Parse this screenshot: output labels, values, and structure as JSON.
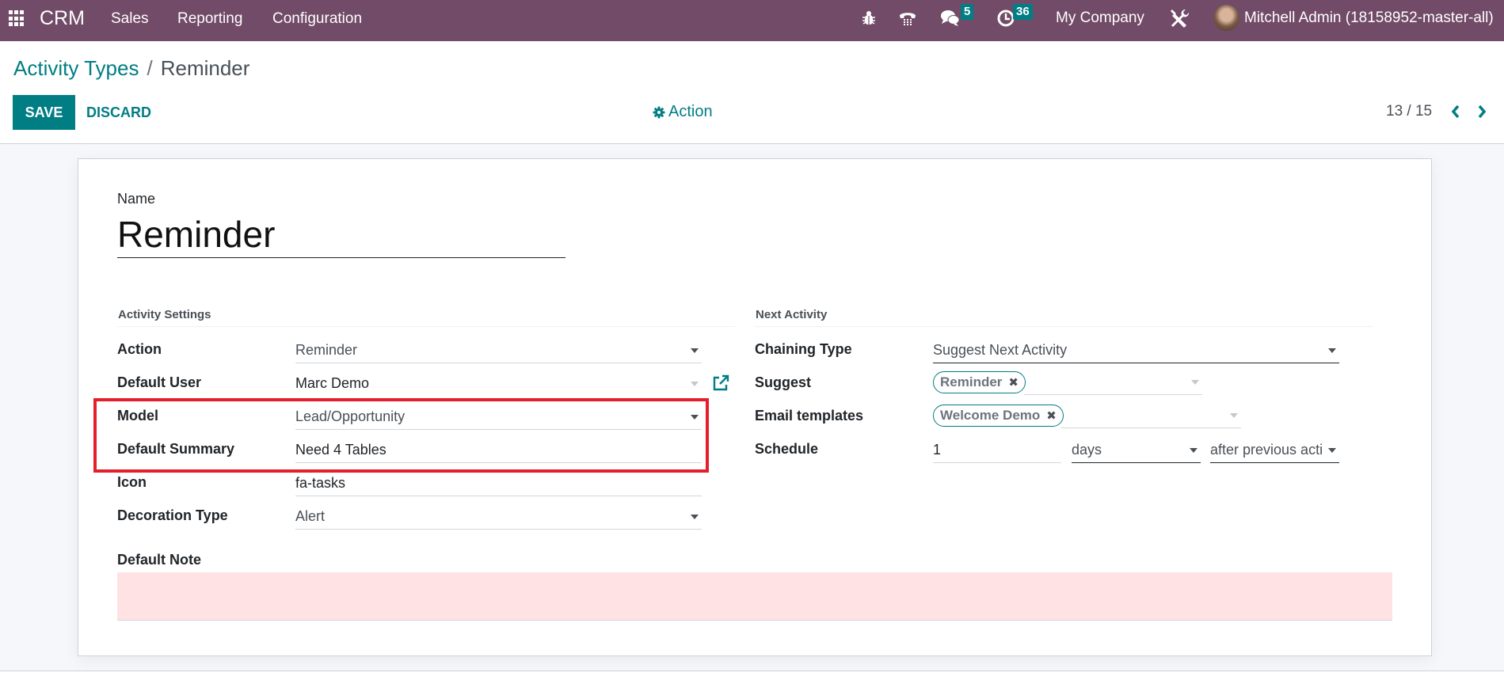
{
  "navbar": {
    "brand": "CRM",
    "menus": [
      "Sales",
      "Reporting",
      "Configuration"
    ],
    "systray": {
      "debug_icon": "bug-icon",
      "phone_icon": "phone-icon",
      "messages_icon": "comments-icon",
      "messages_count": "5",
      "activities_icon": "clock-icon",
      "activities_count": "36",
      "company": "My Company",
      "settings_icon": "tools-icon",
      "user": "Mitchell Admin (18158952-master-all)"
    },
    "color": "#714b67"
  },
  "breadcrumb": {
    "parent": "Activity Types",
    "separator": "/",
    "current": "Reminder"
  },
  "toolbar": {
    "save_label": "SAVE",
    "discard_label": "DISCARD",
    "action_label": "Action",
    "pager": "13 / 15"
  },
  "form": {
    "name_label": "Name",
    "name_value": "Reminder",
    "activity_settings": {
      "title": "Activity Settings",
      "fields": {
        "action": {
          "label": "Action",
          "value": "Reminder"
        },
        "default_user": {
          "label": "Default User",
          "value": "Marc Demo"
        },
        "model": {
          "label": "Model",
          "value": "Lead/Opportunity"
        },
        "default_summary": {
          "label": "Default Summary",
          "value": "Need 4 Tables"
        },
        "icon": {
          "label": "Icon",
          "value": "fa-tasks"
        },
        "decoration_type": {
          "label": "Decoration Type",
          "value": "Alert"
        }
      }
    },
    "next_activity": {
      "title": "Next Activity",
      "fields": {
        "chaining_type": {
          "label": "Chaining Type",
          "value": "Suggest Next Activity"
        },
        "suggest": {
          "label": "Suggest",
          "tags": [
            "Reminder"
          ]
        },
        "email_templates": {
          "label": "Email templates",
          "tags": [
            "Welcome Demo"
          ]
        },
        "schedule": {
          "label": "Schedule",
          "count": "1",
          "unit": "days",
          "relation": "after previous acti"
        }
      }
    },
    "default_note": {
      "label": "Default Note",
      "value": ""
    }
  },
  "colors": {
    "accent": "#017e84",
    "highlight": "#e41e2b",
    "note_bg": "#ffe3e4"
  }
}
